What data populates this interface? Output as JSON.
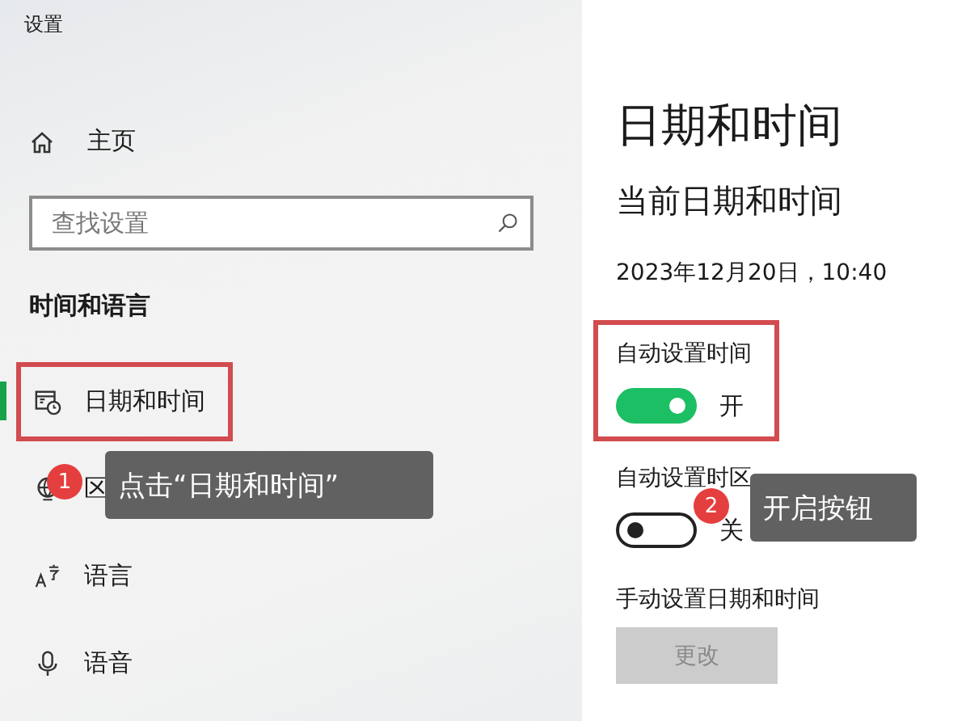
{
  "window": {
    "title": "设置"
  },
  "sidebar": {
    "home": "主页",
    "search": {
      "placeholder": "查找设置"
    },
    "section": "时间和语言",
    "items": [
      {
        "label": "日期和时间",
        "selected": true,
        "highlighted": true
      },
      {
        "label": "区",
        "selected": false,
        "highlighted": false
      },
      {
        "label": "语言",
        "selected": false,
        "highlighted": false
      },
      {
        "label": "语音",
        "selected": false,
        "highlighted": false
      }
    ]
  },
  "content": {
    "title": "日期和时间",
    "subtitle": "当前日期和时间",
    "datetime": "2023年12月20日，10:40",
    "settings": [
      {
        "label": "自动设置时间",
        "on": true,
        "state_text": "开",
        "highlighted": true
      },
      {
        "label": "自动设置时区",
        "on": false,
        "state_text": "关",
        "highlighted": false
      }
    ],
    "manual": {
      "label": "手动设置日期和时间",
      "button": {
        "label": "更改",
        "disabled": true
      }
    }
  },
  "annotations": [
    {
      "number": "1",
      "text": "点击“日期和时间”"
    },
    {
      "number": "2",
      "text": "开启按钮"
    }
  ]
}
